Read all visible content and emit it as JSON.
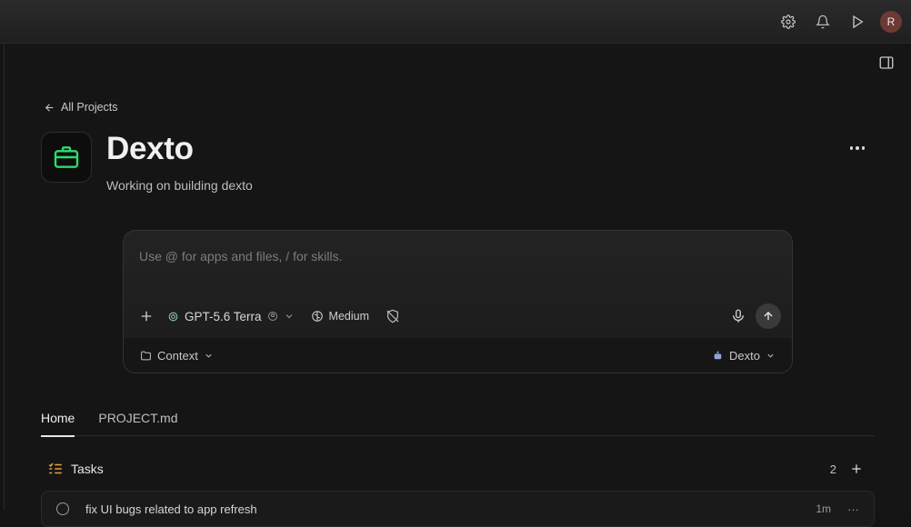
{
  "topbar": {
    "icons": [
      "gear-icon",
      "bell-icon",
      "play-icon"
    ],
    "avatar_initial": "R"
  },
  "back_link": {
    "label": "All Projects"
  },
  "project": {
    "title": "Dexto",
    "subtitle": "Working on building dexto",
    "icon": "briefcase-icon",
    "accent": "#2fd96f"
  },
  "composer": {
    "placeholder": "Use @ for apps and files, / for skills.",
    "model_label": "GPT-5.6 Terra",
    "effort_label": "Medium",
    "context_label": "Context",
    "agent_label": "Dexto"
  },
  "tabs": [
    {
      "label": "Home",
      "active": true
    },
    {
      "label": "PROJECT.md",
      "active": false
    }
  ],
  "tasks": {
    "title": "Tasks",
    "count": "2",
    "items": [
      {
        "title": "fix UI bugs related to app refresh",
        "time": "1m"
      }
    ]
  }
}
